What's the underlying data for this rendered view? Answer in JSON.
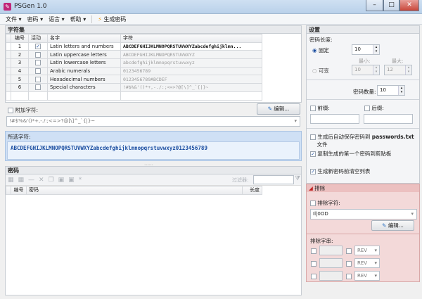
{
  "window": {
    "title": "PSGen 1.0",
    "app_icon": "key-icon"
  },
  "menu": [
    "文件",
    "密码",
    "语言",
    "帮助"
  ],
  "toolbar": {
    "generate_label": "生成密码"
  },
  "charsets": {
    "title": "字符集",
    "columns": [
      "编号",
      "活动",
      "名字",
      "字符"
    ],
    "rows": [
      {
        "num": "1",
        "active": true,
        "name": "Latin letters and numbers",
        "chars": "ABCDEFGHIJKLMNOPQRSTUVWXYZabcdefghijklmn..."
      },
      {
        "num": "2",
        "active": false,
        "name": "Latin uppercase letters",
        "chars": "ABCDEFGHIJKLMNOPQRSTUVWXYZ"
      },
      {
        "num": "3",
        "active": false,
        "name": "Latin lowercase letters",
        "chars": "abcdefghijklmnopqrstuvwxyz"
      },
      {
        "num": "4",
        "active": false,
        "name": "Arabic numerals",
        "chars": "0123456789"
      },
      {
        "num": "5",
        "active": false,
        "name": "Hexadecimal numbers",
        "chars": "0123456789ABCDEF"
      },
      {
        "num": "6",
        "active": false,
        "name": "Special characters",
        "chars": "!#$%&'()*+,-./:;<=>?@[\\]^_`{|}~"
      }
    ],
    "extra_label": "附加字符:",
    "extra_value": "!#$%&'()*+,-./:;<=>?@[\\]^_`{|}~",
    "edit_label": "编辑...",
    "selected_label": "所选字符:",
    "selected_value": "ABCDEFGHIJKLMNOPQRSTUVWXYZabcdefghijklmnopqrstuvwxyz0123456789"
  },
  "passwords": {
    "title": "密码",
    "filter_label": "过滤器:",
    "columns": [
      "编号",
      "密码",
      "长度"
    ]
  },
  "settings": {
    "title": "设置",
    "length_label": "密码长度:",
    "fixed_label": "固定",
    "fixed_value": "10",
    "variable_label": "可变",
    "min_label": "最小:",
    "max_label": "最大:",
    "min_value": "10",
    "max_value": "12",
    "count_label": "密码数量:",
    "count_value": "10",
    "prefix_label": "前缀:",
    "suffix_label": "后缀:",
    "autosave_label": "生成后自动保存密码到",
    "autosave_file": "passwords.txt",
    "autosave_suffix": "文件",
    "copy_label": "复制生成的第一个密码到剪贴板",
    "clear_label": "生成新密码前清空列表"
  },
  "exclude": {
    "title": "排除",
    "chars_label": "排除字符:",
    "chars_value": "Il|0OD",
    "edit_label": "编辑...",
    "strings_label": "排除字串:",
    "rev": "REV"
  },
  "colors": {
    "accent": "#1a4da0",
    "exclude_bg": "#f3d9d9"
  }
}
